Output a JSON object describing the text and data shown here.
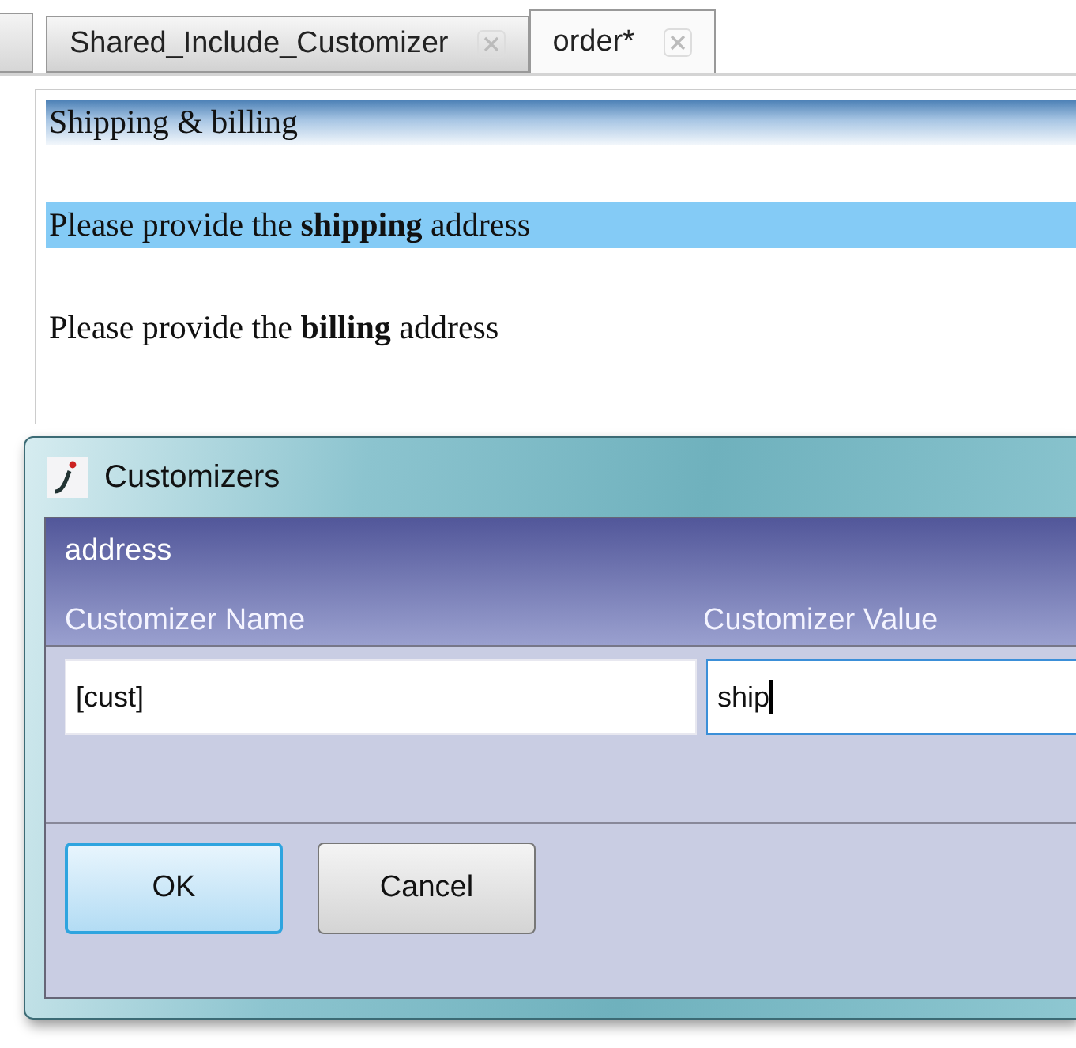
{
  "tabs": [
    {
      "label": "Shared_Include_Customizer",
      "selected": false
    },
    {
      "label": "order*",
      "selected": true
    }
  ],
  "document": [
    {
      "kind": "heading",
      "text": "Shipping & billing"
    },
    {
      "kind": "paragraph",
      "text": "Please provide the **shipping** address",
      "selected": true
    },
    {
      "kind": "paragraph",
      "text": "Please provide the **billing** address",
      "selected": false
    }
  ],
  "dialog": {
    "title": "Customizers",
    "section": "address",
    "columns": [
      {
        "label": "Customizer Name",
        "value": "[cust]",
        "focused": false
      },
      {
        "label": "Customizer Value",
        "value": "ship",
        "focused": true
      }
    ],
    "buttons": [
      {
        "label": "OK",
        "default": true
      },
      {
        "label": "Cancel",
        "default": false
      }
    ]
  }
}
